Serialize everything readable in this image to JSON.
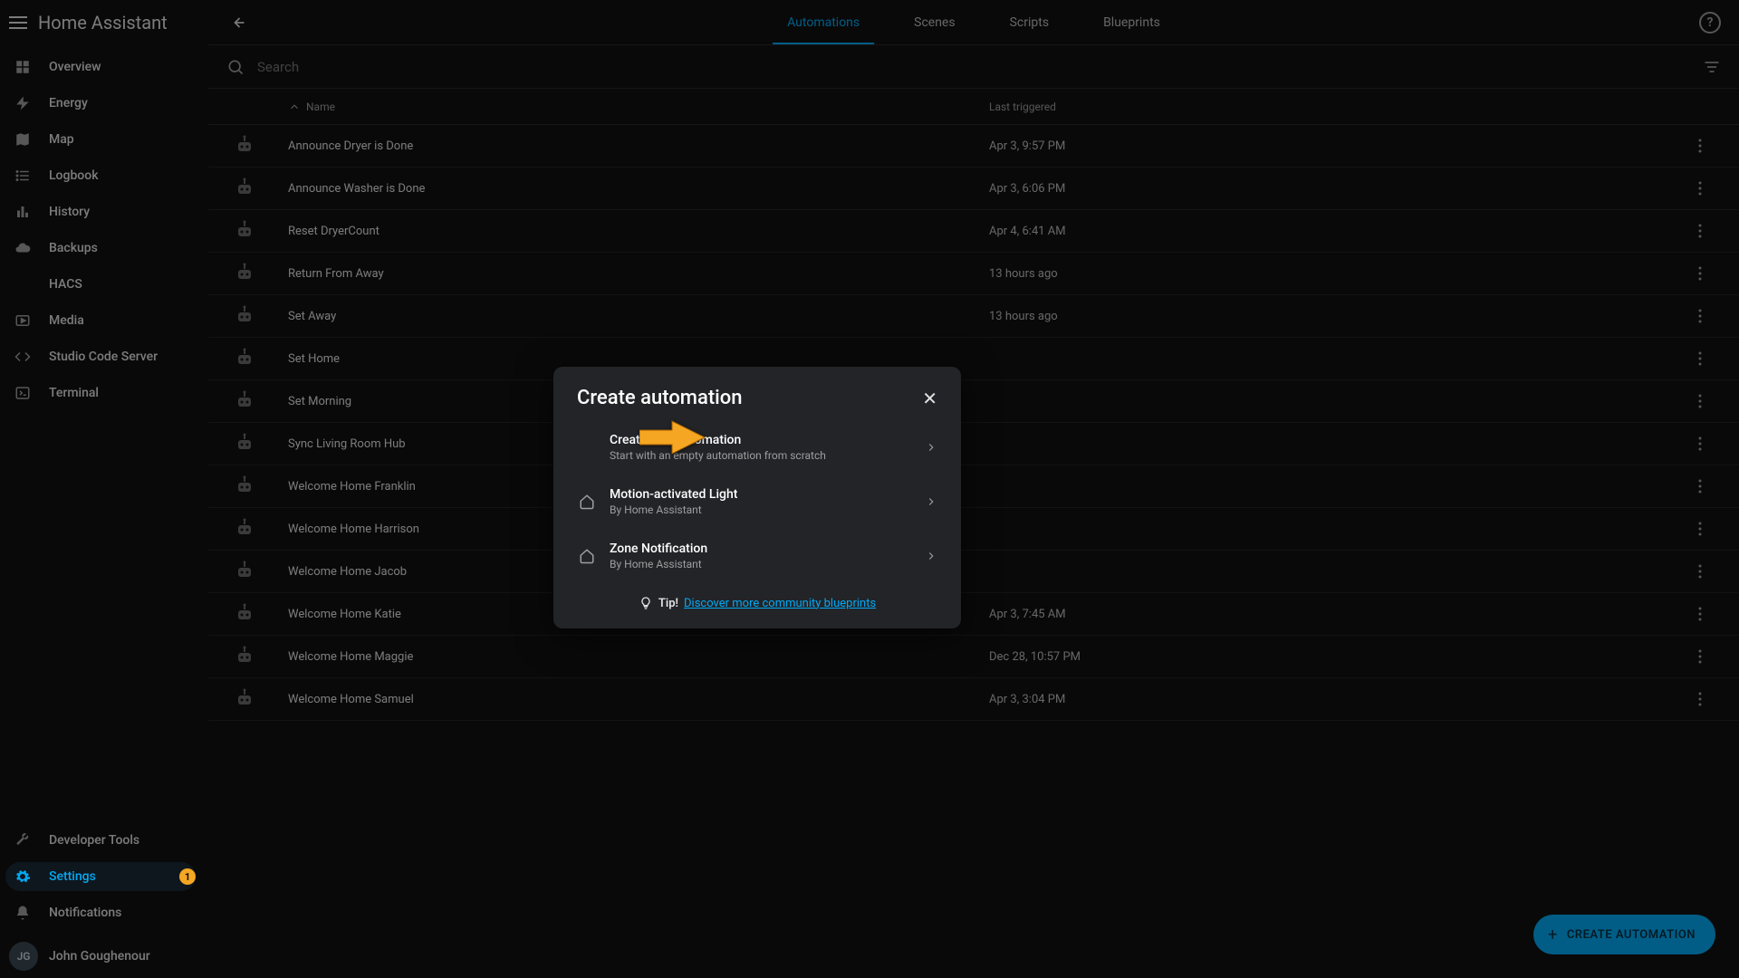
{
  "app": {
    "title": "Home Assistant"
  },
  "sidebar": {
    "items": [
      {
        "label": "Overview",
        "icon": "dashboard"
      },
      {
        "label": "Energy",
        "icon": "bolt"
      },
      {
        "label": "Map",
        "icon": "map"
      },
      {
        "label": "Logbook",
        "icon": "list"
      },
      {
        "label": "History",
        "icon": "chart"
      },
      {
        "label": "Backups",
        "icon": "cloud"
      },
      {
        "label": "HACS",
        "icon": ""
      },
      {
        "label": "Media",
        "icon": "media"
      },
      {
        "label": "Studio Code Server",
        "icon": "code"
      },
      {
        "label": "Terminal",
        "icon": "terminal"
      }
    ],
    "bottom": [
      {
        "label": "Developer Tools",
        "icon": "wrench"
      },
      {
        "label": "Settings",
        "icon": "gear",
        "active": true,
        "badge": "1"
      },
      {
        "label": "Notifications",
        "icon": "bell"
      }
    ]
  },
  "user": {
    "initials": "JG",
    "name": "John Goughenour"
  },
  "tabs": [
    "Automations",
    "Scenes",
    "Scripts",
    "Blueprints"
  ],
  "active_tab": "Automations",
  "search": {
    "placeholder": "Search"
  },
  "columns": {
    "name": "Name",
    "last_triggered": "Last triggered"
  },
  "rows": [
    {
      "name": "Announce Dryer is Done",
      "last": "Apr 3, 9:57 PM"
    },
    {
      "name": "Announce Washer is Done",
      "last": "Apr 3, 6:06 PM"
    },
    {
      "name": "Reset DryerCount",
      "last": "Apr 4, 6:41 AM"
    },
    {
      "name": "Return From Away",
      "last": "13 hours ago"
    },
    {
      "name": "Set Away",
      "last": "13 hours ago"
    },
    {
      "name": "Set Home",
      "last": ""
    },
    {
      "name": "Set Morning",
      "last": ""
    },
    {
      "name": "Sync Living Room Hub",
      "last": ""
    },
    {
      "name": "Welcome Home Franklin",
      "last": ""
    },
    {
      "name": "Welcome Home Harrison",
      "last": ""
    },
    {
      "name": "Welcome Home Jacob",
      "last": ""
    },
    {
      "name": "Welcome Home Katie",
      "last": "Apr 3, 7:45 AM"
    },
    {
      "name": "Welcome Home Maggie",
      "last": "Dec 28, 10:57 PM"
    },
    {
      "name": "Welcome Home Samuel",
      "last": "Apr 3, 3:04 PM"
    }
  ],
  "fab": {
    "label": "CREATE AUTOMATION"
  },
  "dialog": {
    "title": "Create automation",
    "items": [
      {
        "title": "Create new automation",
        "sub": "Start with an empty automation from scratch",
        "icon": ""
      },
      {
        "title": "Motion-activated Light",
        "sub": "By Home Assistant",
        "icon": "home"
      },
      {
        "title": "Zone Notification",
        "sub": "By Home Assistant",
        "icon": "home"
      }
    ],
    "tip_label": "Tip!",
    "tip_link": "Discover more community blueprints"
  }
}
